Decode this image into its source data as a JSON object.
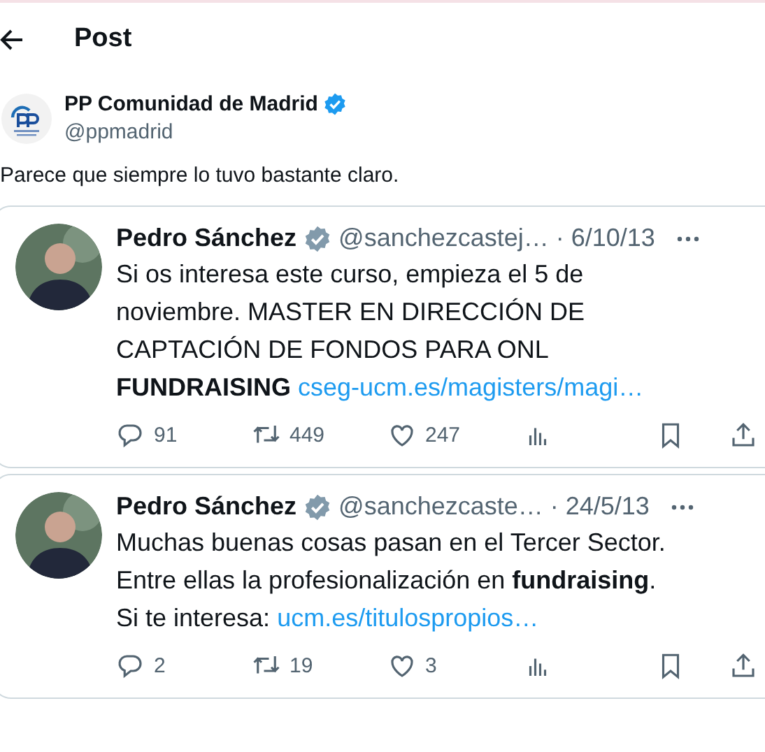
{
  "header": {
    "title": "Post"
  },
  "author": {
    "name": "PP Comunidad de Madrid",
    "verified": true,
    "color": "#1d9bf0",
    "handle": "@ppmadrid"
  },
  "text": "Parece que siempre lo tuvo bastante claro.",
  "quotes": [
    {
      "name": "Pedro Sánchez",
      "verified": true,
      "color": "#829aab",
      "handle": "@sanchezcastej…",
      "date": "· 6/10/13",
      "body": "Si os interesa este curso, empieza el 5 de\nnoviembre. MASTER EN DIRECCIÓN DE\nCAPTACIÓN DE FONDOS PARA ONL\n**FUNDRAISING** ",
      "link": "cseg-ucm.es/magisters/magi…",
      "replies": "91",
      "reposts": "449",
      "likes": "247"
    },
    {
      "name": "Pedro Sánchez",
      "verified": true,
      "color": "#829aab",
      "handle": "@sanchezcaste…",
      "date": "· 24/5/13",
      "body": "Muchas buenas cosas pasan en el Tercer Sector.\nEntre ellas la profesionalización en **fundraising**.\nSi te interesa: ",
      "link": "ucm.es/titulospropios…",
      "replies": "2",
      "reposts": "19",
      "likes": "3"
    }
  ]
}
